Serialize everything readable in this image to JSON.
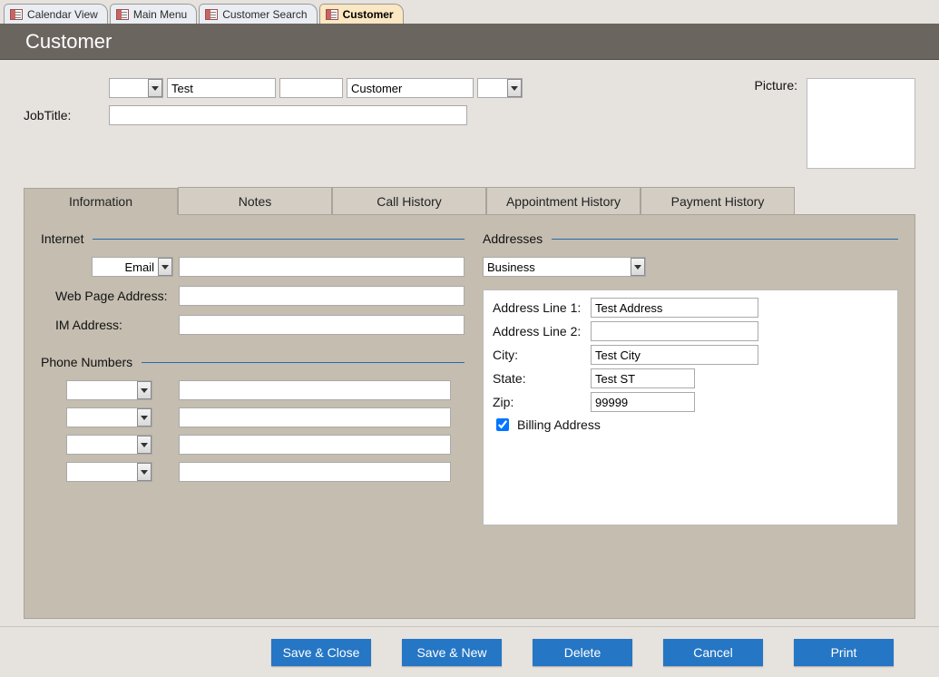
{
  "tabs": [
    {
      "label": "Calendar View"
    },
    {
      "label": "Main Menu"
    },
    {
      "label": "Customer Search"
    },
    {
      "label": "Customer",
      "active": true
    }
  ],
  "header": {
    "title": "Customer"
  },
  "customer": {
    "prefix": "",
    "first_name": "Test",
    "middle_name": "",
    "last_name": "Customer",
    "suffix": "",
    "job_title_label": "JobTitle:",
    "job_title": ""
  },
  "picture": {
    "label": "Picture:"
  },
  "panel_tabs": [
    {
      "label": "Information",
      "active": true
    },
    {
      "label": "Notes"
    },
    {
      "label": "Call History"
    },
    {
      "label": "Appointment History"
    },
    {
      "label": "Payment History"
    }
  ],
  "internet": {
    "legend": "Internet",
    "email_type": "Email",
    "email_value": "",
    "webpage_label": "Web Page Address:",
    "webpage_value": "",
    "im_label": "IM Address:",
    "im_value": ""
  },
  "phone": {
    "legend": "Phone Numbers",
    "rows": [
      {
        "type": "",
        "number": ""
      },
      {
        "type": "",
        "number": ""
      },
      {
        "type": "",
        "number": ""
      },
      {
        "type": "",
        "number": ""
      }
    ]
  },
  "addresses": {
    "legend": "Addresses",
    "type": "Business",
    "line1_label": "Address Line 1:",
    "line1": "Test Address",
    "line2_label": "Address Line 2:",
    "line2": "",
    "city_label": "City:",
    "city": "Test City",
    "state_label": "State:",
    "state": "Test ST",
    "zip_label": "Zip:",
    "zip": "99999",
    "billing_label": "Billing Address",
    "billing_checked": true
  },
  "footer": {
    "save_close": "Save & Close",
    "save_new": "Save & New",
    "delete": "Delete",
    "cancel": "Cancel",
    "print": "Print"
  }
}
